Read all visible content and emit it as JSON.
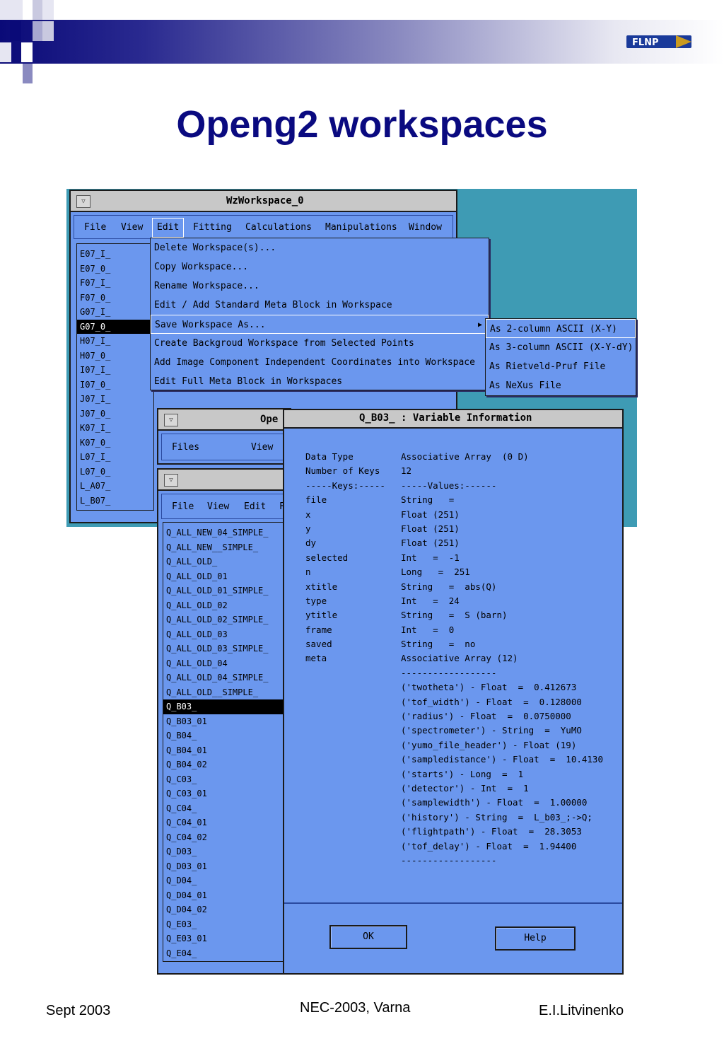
{
  "slide": {
    "title": "Openg2 workspaces",
    "footer_left": "Sept 2003",
    "footer_center": "NEC-2003, Varna",
    "footer_right": "E.I.Litvinenko",
    "logo_text": "FLNP"
  },
  "main_window": {
    "title": "WzWorkspace_0",
    "menu": [
      "File",
      "View",
      "Edit",
      "Fitting",
      "Calculations",
      "Manipulations",
      "Window"
    ],
    "list": [
      "E07_I_",
      "E07_0_",
      "F07_I_",
      "F07_0_",
      "G07_I_",
      "G07_0_",
      "H07_I_",
      "H07_0_",
      "I07_I_",
      "I07_0_",
      "J07_I_",
      "J07_0_",
      "K07_I_",
      "K07_0_",
      "L07_I_",
      "L07_0_",
      "L_A07_",
      "L_B07_"
    ]
  },
  "edit_menu": {
    "items": [
      "Delete Workspace(s)...",
      "Copy Workspace...",
      "Rename Workspace...",
      "Edit / Add Standard Meta Block in Workspace",
      "Save Workspace As...",
      "Create Backgroud Workspace from Selected Points",
      "Add Image Component Independent Coordinates into Workspace",
      "Edit Full Meta Block in Workspaces"
    ]
  },
  "save_submenu": {
    "items": [
      "As 2-column ASCII (X-Y)",
      "As 3-column ASCII (X-Y-dY)",
      "As Rietveld-Pruf File",
      "As NeXus File"
    ]
  },
  "open_window": {
    "title": "Ope",
    "menu": [
      "Files",
      "View"
    ]
  },
  "second_window": {
    "menu": [
      "File",
      "View",
      "Edit",
      "F"
    ],
    "list": [
      "Q_ALL_NEW_04_SIMPLE_",
      "Q_ALL_NEW__SIMPLE_",
      "Q_ALL_OLD_",
      "Q_ALL_OLD_01",
      "Q_ALL_OLD_01_SIMPLE_",
      "Q_ALL_OLD_02",
      "Q_ALL_OLD_02_SIMPLE_",
      "Q_ALL_OLD_03",
      "Q_ALL_OLD_03_SIMPLE_",
      "Q_ALL_OLD_04",
      "Q_ALL_OLD_04_SIMPLE_",
      "Q_ALL_OLD__SIMPLE_",
      "Q_B03_",
      "Q_B03_01",
      "Q_B04_",
      "Q_B04_01",
      "Q_B04_02",
      "Q_C03_",
      "Q_C03_01",
      "Q_C04_",
      "Q_C04_01",
      "Q_C04_02",
      "Q_D03_",
      "Q_D03_01",
      "Q_D04_",
      "Q_D04_01",
      "Q_D04_02",
      "Q_E03_",
      "Q_E03_01",
      "Q_E04_"
    ]
  },
  "info_dialog": {
    "title": "Q_B03_ : Variable Information",
    "rows": [
      {
        "k": "Data Type",
        "v": "Associative Array  (0 D)"
      },
      {
        "k": "Number of Keys",
        "v": "12"
      },
      {
        "k": "-----Keys:-----",
        "v": "-----Values:------"
      },
      {
        "k": "file",
        "v": "String   ="
      },
      {
        "k": "x",
        "v": "Float (251)"
      },
      {
        "k": "y",
        "v": "Float (251)"
      },
      {
        "k": "dy",
        "v": "Float (251)"
      },
      {
        "k": "selected",
        "v": "Int   =  -1"
      },
      {
        "k": "n",
        "v": "Long   =  251"
      },
      {
        "k": "xtitle",
        "v": "String   =  abs(Q)"
      },
      {
        "k": "type",
        "v": "Int   =  24"
      },
      {
        "k": "ytitle",
        "v": "String   =  S (barn)"
      },
      {
        "k": "frame",
        "v": "Int   =  0"
      },
      {
        "k": "saved",
        "v": "String   =  no"
      },
      {
        "k": "meta",
        "v": "Associative Array (12)"
      },
      {
        "k": "",
        "v": "------------------"
      },
      {
        "k": "",
        "v": "('twotheta') - Float  =  0.412673"
      },
      {
        "k": "",
        "v": "('tof_width') - Float  =  0.128000"
      },
      {
        "k": "",
        "v": "('radius') - Float  =  0.0750000"
      },
      {
        "k": "",
        "v": "('spectrometer') - String  =  YuMO"
      },
      {
        "k": "",
        "v": "('yumo_file_header') - Float (19)"
      },
      {
        "k": "",
        "v": "('sampledistance') - Float  =  10.4130"
      },
      {
        "k": "",
        "v": "('starts') - Long  =  1"
      },
      {
        "k": "",
        "v": "('detector') - Int  =  1"
      },
      {
        "k": "",
        "v": "('samplewidth') - Float  =  1.00000"
      },
      {
        "k": "",
        "v": "('history') - String  =  L_b03_;->Q;"
      },
      {
        "k": "",
        "v": "('flightpath') - Float  =  28.3053"
      },
      {
        "k": "",
        "v": "('tof_delay') - Float  =  1.94400"
      },
      {
        "k": "",
        "v": "------------------"
      }
    ],
    "ok_label": "OK",
    "help_label": "Help"
  }
}
